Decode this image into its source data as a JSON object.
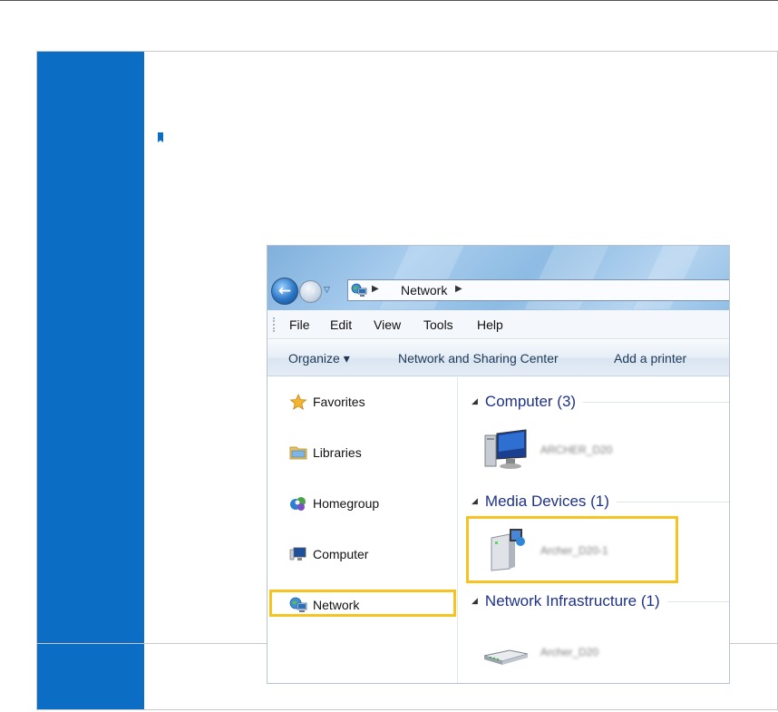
{
  "colors": {
    "side_band": "#0b6dc4",
    "highlight": "#f5c322",
    "group_header_text": "#1e3287"
  },
  "explorer": {
    "address": {
      "icon": "network-icon",
      "location": "Network"
    },
    "menu": [
      "File",
      "Edit",
      "View",
      "Tools",
      "Help"
    ],
    "toolbar": {
      "organize": "Organize ▾",
      "network_sharing": "Network and Sharing Center",
      "add_printer": "Add a printer"
    },
    "nav_pane": {
      "items": [
        {
          "label": "Favorites",
          "icon": "star-icon"
        },
        {
          "label": "Libraries",
          "icon": "libraries-icon"
        },
        {
          "label": "Homegroup",
          "icon": "homegroup-icon"
        },
        {
          "label": "Computer",
          "icon": "computer-icon"
        },
        {
          "label": "Network",
          "icon": "network-icon",
          "highlighted": true
        }
      ]
    },
    "groups": [
      {
        "header": "Computer (3)",
        "device": {
          "name": "ARCHER_D20",
          "icon": "desktop-computer-icon",
          "blurred": true
        }
      },
      {
        "header": "Media Devices (1)",
        "device": {
          "name": "Archer_D20-1",
          "icon": "media-device-icon",
          "blurred": true,
          "highlighted": true
        }
      },
      {
        "header": "Network Infrastructure (1)",
        "device": {
          "name": "Archer_D20",
          "icon": "router-icon",
          "blurred": true
        }
      }
    ]
  }
}
